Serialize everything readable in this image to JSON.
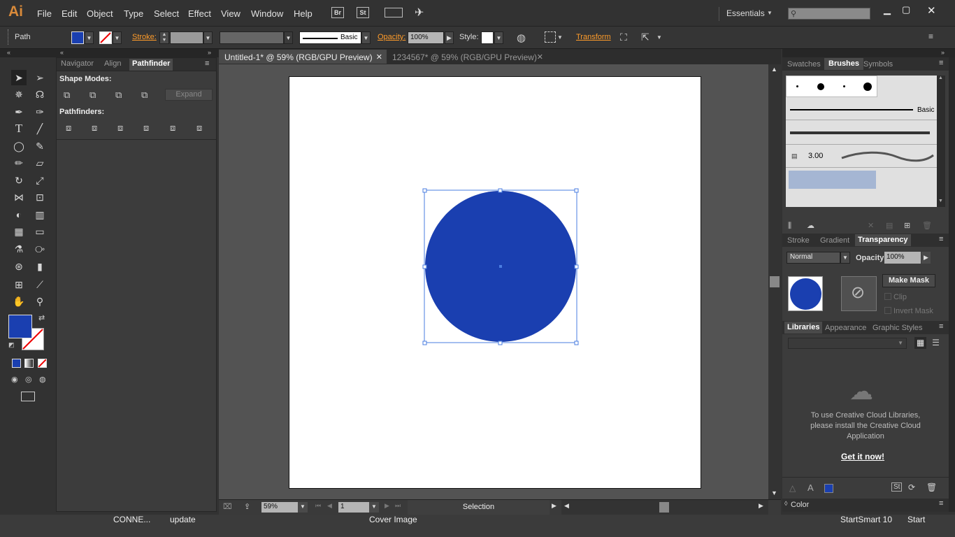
{
  "app": {
    "logo": "Ai"
  },
  "menubar": {
    "items": [
      "File",
      "Edit",
      "Object",
      "Type",
      "Select",
      "Effect",
      "View",
      "Window",
      "Help"
    ],
    "bridge": "Br",
    "stock": "St",
    "workspace": "Essentials"
  },
  "control": {
    "selection_type": "Path",
    "stroke_label": "Stroke:",
    "brush_label": "Basic",
    "opacity_label": "Opacity:",
    "opacity_value": "100%",
    "style_label": "Style:",
    "transform_label": "Transform",
    "fill_color": "#1a3fb0"
  },
  "pathfinder_panel": {
    "tabs": [
      "Navigator",
      "Align",
      "Pathfinder"
    ],
    "shape_modes_label": "Shape Modes:",
    "expand_label": "Expand",
    "pathfinders_label": "Pathfinders:"
  },
  "documents": {
    "tabs": [
      {
        "title": "Untitled-1* @ 59% (RGB/GPU Preview)"
      },
      {
        "title": "1234567* @ 59% (RGB/GPU Preview)"
      }
    ]
  },
  "artwork": {
    "shape": "circle",
    "fill": "#1a3fb0"
  },
  "statusbar": {
    "zoom": "59%",
    "artboard_number": "1",
    "tool_status": "Selection"
  },
  "brushes_panel": {
    "tabs": [
      "Swatches",
      "Brushes",
      "Symbols"
    ],
    "basic_label": "Basic",
    "size_value": "3.00"
  },
  "transparency_panel": {
    "tabs": [
      "Stroke",
      "Gradient",
      "Transparency"
    ],
    "blend_mode": "Normal",
    "opacity_label": "Opacity:",
    "opacity_value": "100%",
    "make_mask_label": "Make Mask",
    "clip_label": "Clip",
    "invert_mask_label": "Invert Mask"
  },
  "libraries_panel": {
    "tabs": [
      "Libraries",
      "Appearance",
      "Graphic Styles"
    ],
    "message": "To use Creative Cloud Libraries, please install the Creative Cloud Application",
    "link": "Get it now!"
  },
  "color_panel": {
    "label": "Color"
  },
  "taskbar": {
    "items": [
      "CONNE...",
      "update",
      "Cover Image",
      "StartSmart 10",
      "Start"
    ]
  }
}
